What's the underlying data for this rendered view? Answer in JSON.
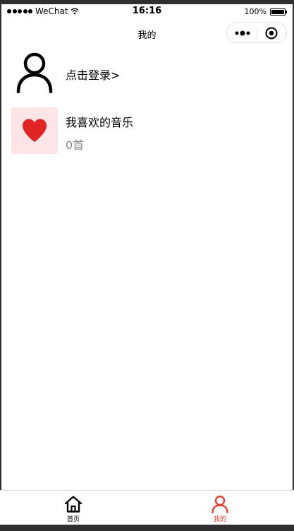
{
  "status_bar": {
    "carrier": "WeChat",
    "time": "16:16",
    "battery": "100%"
  },
  "nav": {
    "title": "我的"
  },
  "login": {
    "text": "点击登录>"
  },
  "favorites": {
    "title": "我喜欢的音乐",
    "count": "0首"
  },
  "tabs": [
    {
      "label": "首页",
      "icon": "home-icon",
      "active": false
    },
    {
      "label": "我的",
      "icon": "person-icon",
      "active": true
    }
  ],
  "colors": {
    "accent": "#e8412e",
    "heart": "#e02424",
    "cover_bg": "#fde4e6",
    "muted_text": "#8a8a8a"
  }
}
